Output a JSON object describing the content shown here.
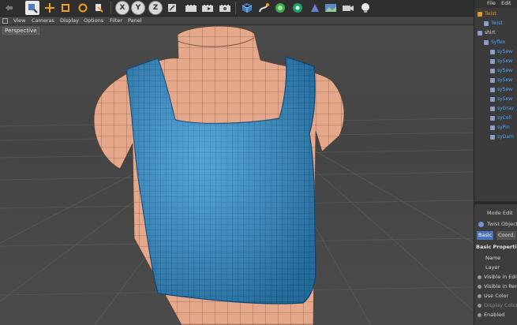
{
  "viewport_menu": {
    "view": "View",
    "cameras": "Cameras",
    "display": "Display",
    "options": "Options",
    "filter": "Filter",
    "panel": "Panel"
  },
  "viewport_label": "Perspective",
  "toolbar": {
    "axis_x": "X",
    "axis_y": "Y",
    "axis_z": "Z"
  },
  "right_panel": {
    "menu_file": "File",
    "menu_edit": "Edit",
    "tree": [
      {
        "label": "Twist",
        "indent": 0
      },
      {
        "label": "Twist",
        "indent": 1
      },
      {
        "label": "shirt",
        "indent": 0
      },
      {
        "label": "Syflex",
        "indent": 1
      },
      {
        "label": "sySew",
        "indent": 2
      },
      {
        "label": "sySew",
        "indent": 2
      },
      {
        "label": "sySew",
        "indent": 2
      },
      {
        "label": "sySew",
        "indent": 2
      },
      {
        "label": "sySew",
        "indent": 2
      },
      {
        "label": "sySew",
        "indent": 2
      },
      {
        "label": "syGrav",
        "indent": 2
      },
      {
        "label": "syColl",
        "indent": 2
      },
      {
        "label": "syPin",
        "indent": 2
      },
      {
        "label": "syDam",
        "indent": 2
      }
    ],
    "attr_menu_mode": "Mode",
    "attr_menu_edit": "Edit",
    "object_name": "Twist Object",
    "tab_basic": "Basic",
    "tab_coord": "Coord.",
    "section": "Basic Properties",
    "props": [
      "Name",
      "Layer",
      "Visible in Edit",
      "Visible in Ren",
      "Use Color",
      "Display Color",
      "Enabled"
    ]
  },
  "colors": {
    "shirt": "#2f8fcf",
    "skin": "#e8a98c",
    "selected": "#e39a2c",
    "tree_text": "#4aa8ff"
  }
}
